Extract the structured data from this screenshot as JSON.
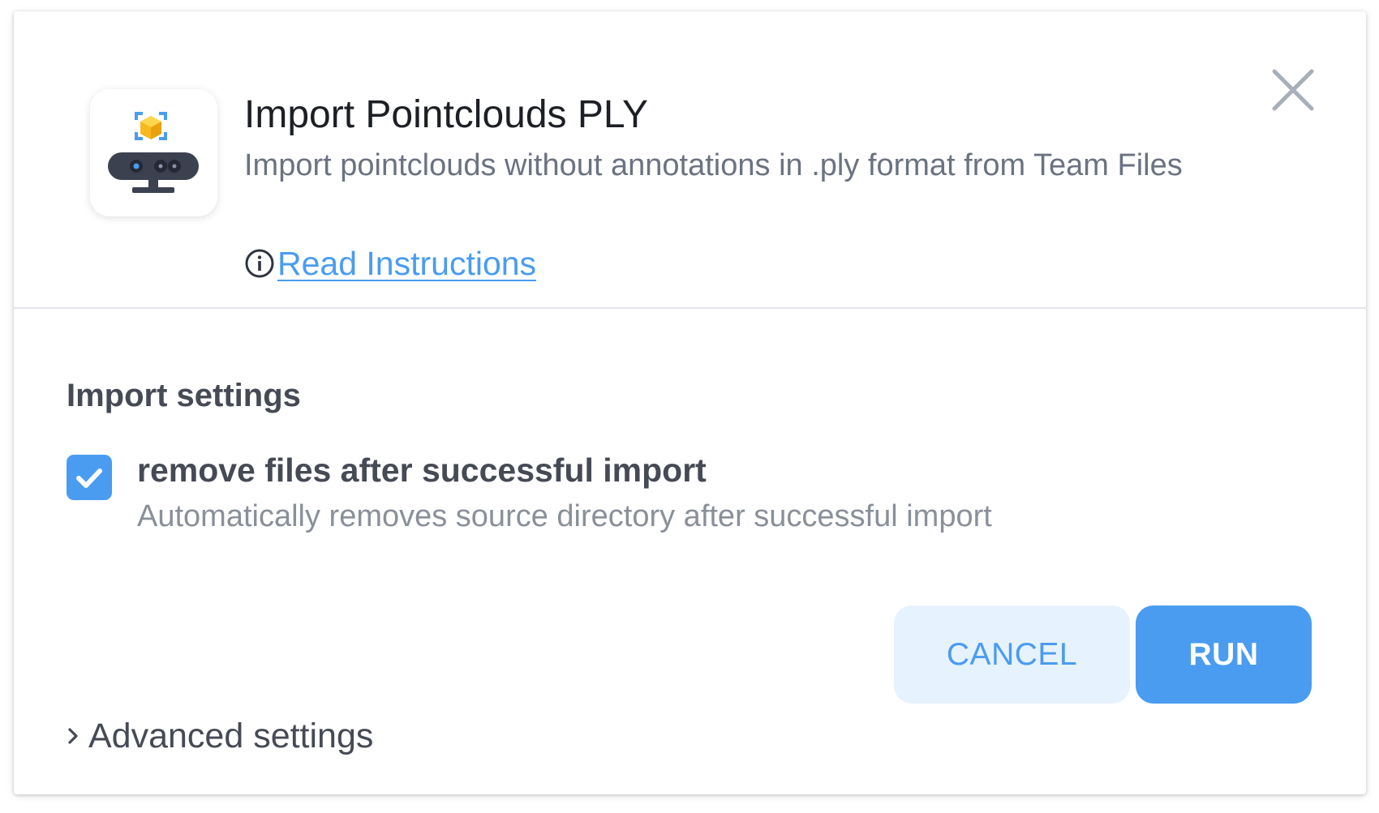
{
  "app": {
    "title": "Import Pointclouds PLY",
    "description": "Import pointclouds without annotations in .ply format from Team Files",
    "instructions_label": "Read Instructions",
    "icon": "pointcloud-camera-icon"
  },
  "settings": {
    "section_title": "Import settings",
    "remove_files": {
      "label": "remove files after successful import",
      "description": "Automatically removes source directory after successful import",
      "checked": true
    },
    "advanced_label": "Advanced settings"
  },
  "actions": {
    "cancel_label": "CANCEL",
    "run_label": "RUN"
  },
  "colors": {
    "accent": "#4a9cf0",
    "cancel_bg": "#e6f2fd",
    "text_dark": "#454a54",
    "text_muted": "#8a9099"
  }
}
